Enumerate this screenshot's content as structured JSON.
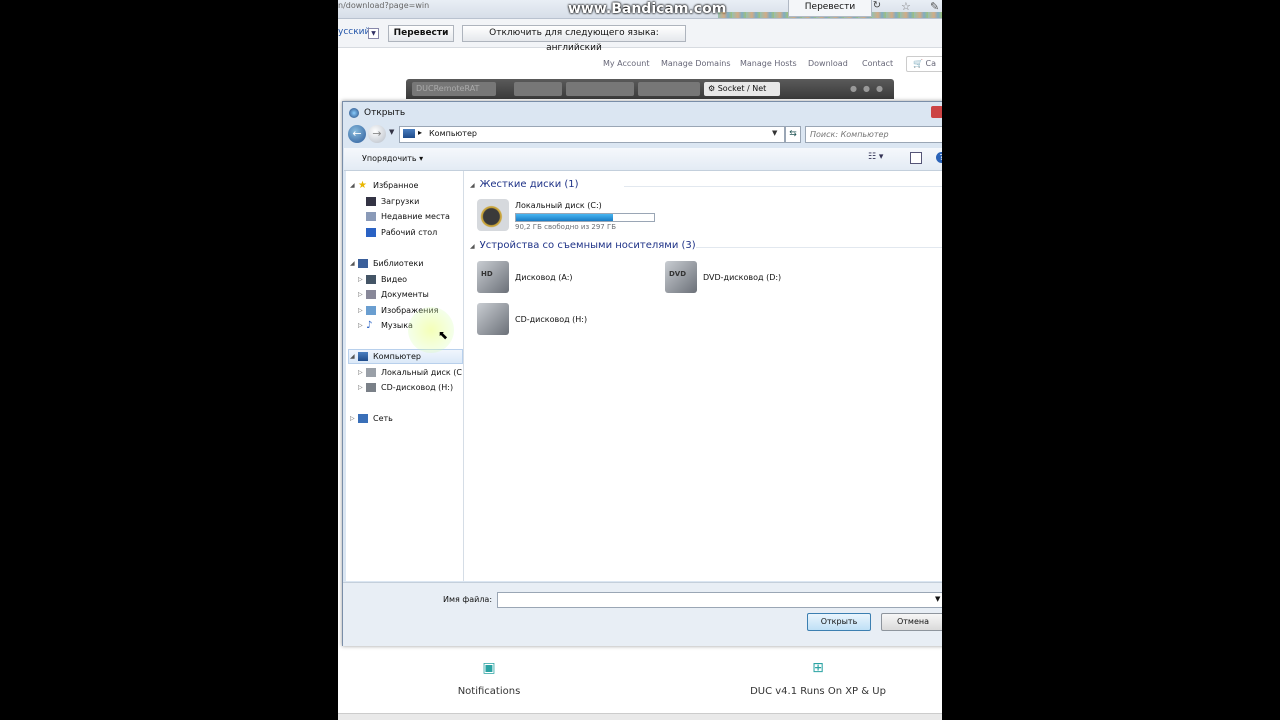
{
  "browser": {
    "url_fragment": "n/download?page=win",
    "watermark": "www.Bandicam.com",
    "translate_button": "Перевести",
    "refresh_icon": "refresh-icon",
    "star_icon": "star-icon"
  },
  "translate_bar": {
    "language": "усский",
    "translate_label": "Перевести",
    "disable_label": "Отключить для следующего языка: английский"
  },
  "site_nav": {
    "items": [
      "My Account",
      "Manage Domains",
      "Manage Hosts",
      "Download",
      "Contact"
    ],
    "cart_label": "Ca"
  },
  "app_tabs": {
    "items": [
      "DUCRemoteRAT",
      "",
      "",
      ""
    ],
    "active_label": "Socket / Net"
  },
  "dialog": {
    "title": "Открыть",
    "address_path": "Компьютер",
    "search_placeholder": "Поиск: Компьютер",
    "organize_label": "Упорядочить ▾",
    "nav": {
      "favorites": "Избранное",
      "downloads": "Загрузки",
      "recent": "Недавние места",
      "desktop": "Рабочий стол",
      "libraries": "Библиотеки",
      "video": "Видео",
      "documents": "Документы",
      "images": "Изображения",
      "music": "Музыка",
      "computer": "Компьютер",
      "local_disk": "Локальный диск (C",
      "cd_drive": "CD-дисковод (H:)",
      "network": "Сеть"
    },
    "groups": {
      "hard_disks": "Жесткие диски (1)",
      "removable": "Устройства со съемными носителями (3)"
    },
    "drives": {
      "c_label": "Локальный диск (C:)",
      "c_free": "90,2 ГБ свободно из 297 ГБ",
      "c_used_fraction": 0.7,
      "a_label": "Дисковод (A:)",
      "d_label": "DVD-дисковод (D:)",
      "h_label": "CD-дисковод (H:)",
      "a_tag": "HD",
      "d_tag": "DVD"
    },
    "filename_label": "Имя файла:",
    "filename_value": "",
    "open_button": "Открыть",
    "cancel_button": "Отмена"
  },
  "page_features": {
    "notifications": "Notifications",
    "duc": "DUC v4.1 Runs On XP & Up"
  }
}
